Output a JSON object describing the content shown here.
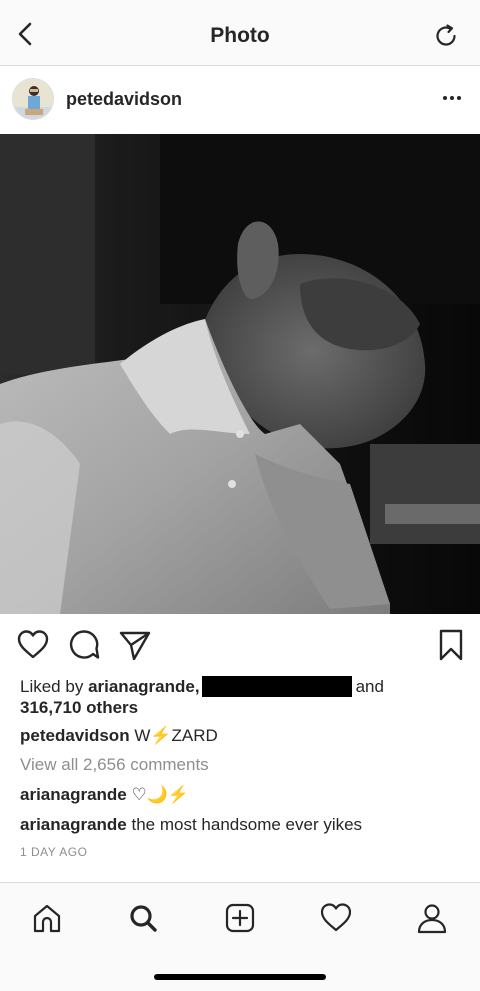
{
  "header": {
    "title": "Photo"
  },
  "post": {
    "username": "petedavidson",
    "liked_by_prefix": "Liked by",
    "liked_by_user": "arianagrande,",
    "liked_by_and": "and",
    "liked_count": "316,710 others",
    "caption_user": "petedavidson",
    "caption_text_a": "W",
    "caption_bolt": "⚡",
    "caption_text_b": "ZARD",
    "view_all": "View all 2,656 comments",
    "comments": [
      {
        "user": "arianagrande",
        "text": "♡🌙⚡"
      },
      {
        "user": "arianagrande",
        "text": "the most handsome ever yikes"
      }
    ],
    "time_ago": "1 DAY AGO"
  },
  "colors": {
    "text": "#262626",
    "muted": "#8e8e8e",
    "divider": "#dbdbdb",
    "bolt": "#f5b301"
  },
  "icons": [
    "back-chevron-icon",
    "refresh-icon",
    "more-icon",
    "heart-icon",
    "comment-icon",
    "share-icon",
    "bookmark-icon",
    "home-icon",
    "search-icon",
    "add-icon",
    "activity-heart-icon",
    "profile-icon"
  ]
}
